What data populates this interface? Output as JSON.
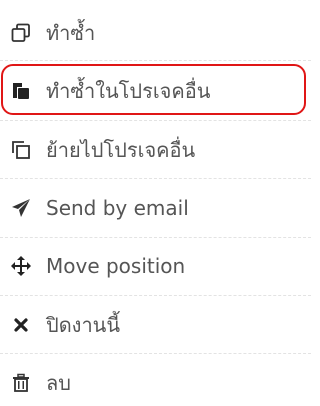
{
  "menu": {
    "items": [
      {
        "label": "ทำซ้ำ",
        "icon": "clone-icon"
      },
      {
        "label": "ทำซ้ำในโปรเจคอื่น",
        "icon": "copy-to-project-icon"
      },
      {
        "label": "ย้ายไปโปรเจคอื่น",
        "icon": "move-to-project-icon"
      },
      {
        "label": "Send by email",
        "icon": "paper-plane-icon"
      },
      {
        "label": "Move position",
        "icon": "move-arrows-icon"
      },
      {
        "label": "ปิดงานนี้",
        "icon": "close-icon"
      },
      {
        "label": "ลบ",
        "icon": "trash-icon"
      }
    ],
    "highlighted_index": 1
  },
  "colors": {
    "text": "#555555",
    "icon": "#333333",
    "highlight": "#e01616",
    "divider": "#e3e3e3"
  }
}
